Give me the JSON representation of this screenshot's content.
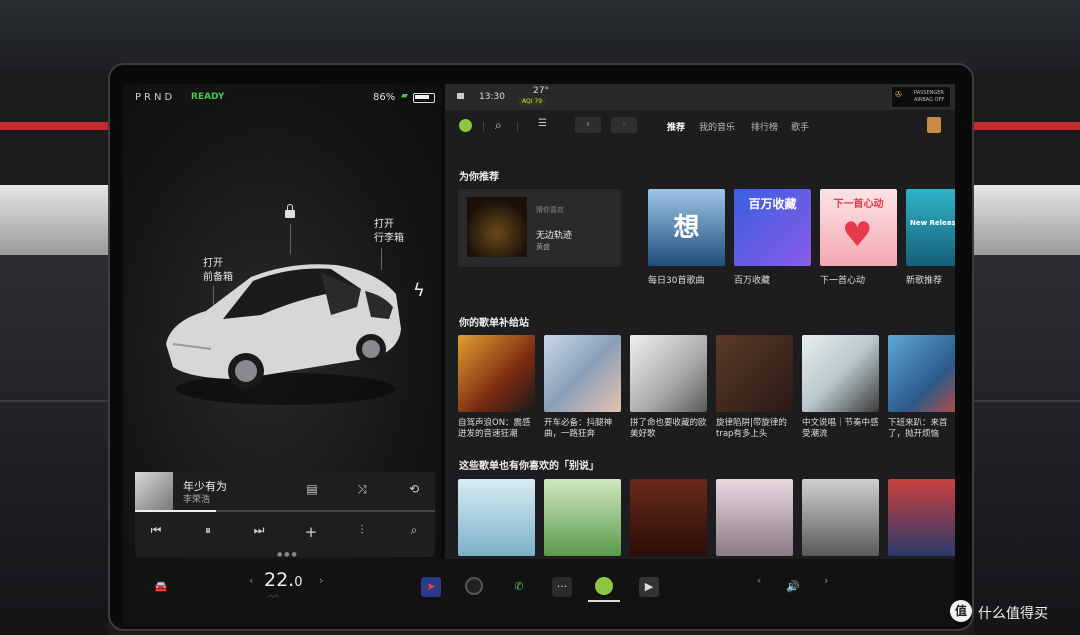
{
  "vehicle": {
    "gear": "PRND",
    "status": "READY",
    "battery_pct": "86%",
    "labels": {
      "frunk_line1": "打开",
      "frunk_line2": "前备箱",
      "trunk_line1": "打开",
      "trunk_line2": "行李箱"
    }
  },
  "now_playing": {
    "title": "年少有为",
    "artist": "李荣浩",
    "progress": 0.27,
    "controls": [
      "lyrics-icon",
      "shuffle-icon",
      "repeat-icon",
      "previous-icon",
      "pause-icon",
      "next-icon",
      "add-icon",
      "equalizer-icon",
      "search-icon"
    ],
    "control_glyphs": {
      "lyrics": "▤",
      "shuffle": "⤨",
      "repeat": "⟲",
      "prev": "⏮",
      "pause": "⏸",
      "next": "⏭",
      "add": "+",
      "eq": "⫶",
      "search": "⌕"
    }
  },
  "status_bar": {
    "time": "13:30",
    "temperature": "27°",
    "aqi": "AQI 79",
    "airbag_line1": "PASSENGER",
    "airbag_line2": "AIRBAG OFF"
  },
  "music_app": {
    "tabs": [
      "推荐",
      "我的音乐",
      "排行榜",
      "歌手"
    ],
    "active_tab": "推荐",
    "sections": {
      "for_you": "为你推荐",
      "playlist_supply": "你的歌单补给站",
      "also_like": "这些歌单也有你喜欢的「别说」"
    },
    "featured": {
      "subtitle": "猜你喜欢",
      "title": "无边轨迹",
      "artist": "黄盛"
    },
    "recommendations": [
      {
        "label": "每日30首歌曲",
        "tile_text": "想"
      },
      {
        "label": "百万收藏",
        "tile_text": "百万收藏"
      },
      {
        "label": "下一首心动",
        "tile_text": "下一首心动"
      },
      {
        "label": "新歌推荐",
        "tile_text": "New Release"
      }
    ],
    "playlists": [
      {
        "label": "自驾声浪ON：震感迸发的音速狂潮"
      },
      {
        "label": "开车必备：抖腿神曲，一路狂奔"
      },
      {
        "label": "拼了命也要收藏的欧美好歌"
      },
      {
        "label": "旋律陷阱|带旋律的trap有多上头"
      },
      {
        "label": "中文说唱｜节奏中感受潮流"
      },
      {
        "label": "下班来趴：来首了，抛开烦恼"
      }
    ]
  },
  "climate": {
    "temperature": "22.",
    "temperature_decimal": "0"
  },
  "dock": {
    "chevron_left": "‹",
    "chevron_right": "›"
  },
  "watermark": {
    "logo": "值",
    "text": "什么值得买"
  }
}
